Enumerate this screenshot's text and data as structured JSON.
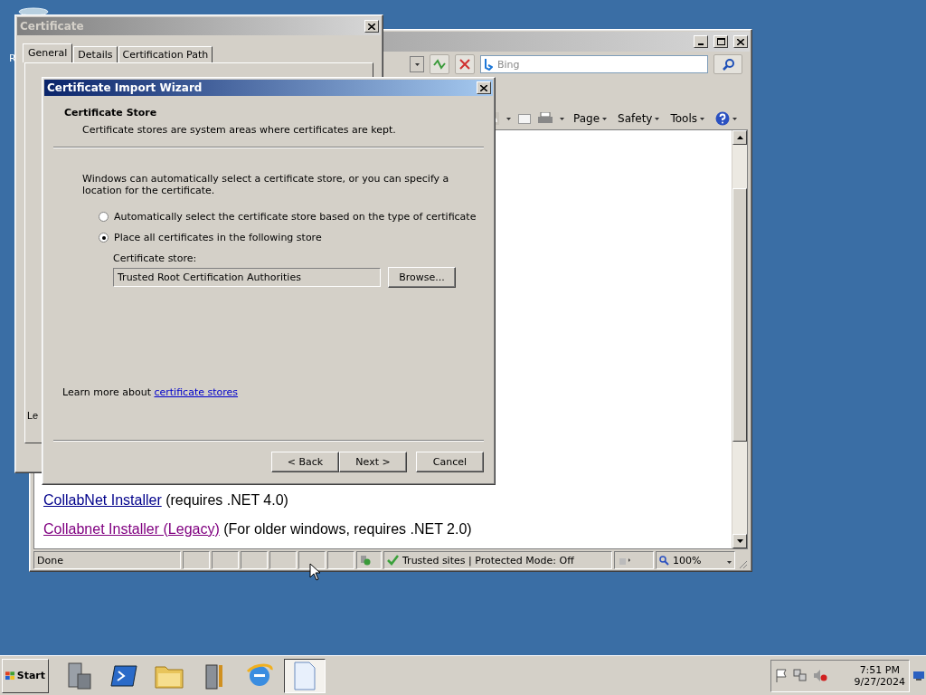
{
  "desktop": {
    "icons": [
      {
        "label": "R"
      }
    ]
  },
  "browser": {
    "search": {
      "placeholder": "Bing"
    },
    "command_bar": [
      {
        "label": "Page"
      },
      {
        "label": "Safety"
      },
      {
        "label": "Tools"
      }
    ],
    "links": [
      {
        "text": "CollabNet Installer",
        "note": "(requires .NET 4.0)",
        "visited": false
      },
      {
        "text": "Collabnet Installer (Legacy)",
        "note": "(For older windows, requires .NET 2.0)",
        "visited": true
      }
    ],
    "status_bar": {
      "status": "Done",
      "zone": "Trusted sites | Protected Mode: Off",
      "zoom": "100%"
    }
  },
  "certificate_dialog": {
    "title": "Certificate",
    "tabs": [
      {
        "label": "General",
        "selected": true
      },
      {
        "label": "Details",
        "selected": false
      },
      {
        "label": "Certification Path",
        "selected": false
      }
    ],
    "fragment": "Le"
  },
  "wizard": {
    "title": "Certificate Import Wizard",
    "heading": "Certificate Store",
    "subheading": "Certificate stores are system areas where certificates are kept.",
    "intro": "Windows can automatically select a certificate store, or you can specify a location for the certificate.",
    "options": [
      {
        "label": "Automatically select the certificate store based on the type of certificate",
        "selected": false
      },
      {
        "label": "Place all certificates in the following store",
        "selected": true
      }
    ],
    "store_label": "Certificate store:",
    "store_value": "Trusted Root Certification Authorities",
    "browse": "Browse...",
    "learn_more": {
      "text": "Learn more about ",
      "link": "certificate stores"
    },
    "buttons": [
      {
        "label": "< Back"
      },
      {
        "label": "Next >"
      },
      {
        "label": "Cancel"
      }
    ]
  },
  "taskbar": {
    "start": "Start",
    "apps": [
      {
        "kind": "server",
        "selected": false
      },
      {
        "kind": "shell",
        "selected": false
      },
      {
        "kind": "folder",
        "selected": false
      },
      {
        "kind": "tools",
        "selected": false
      },
      {
        "kind": "browser",
        "selected": false
      },
      {
        "kind": "document",
        "selected": true
      }
    ],
    "clock": {
      "time": "7:51 PM",
      "date": "9/27/2024"
    }
  }
}
